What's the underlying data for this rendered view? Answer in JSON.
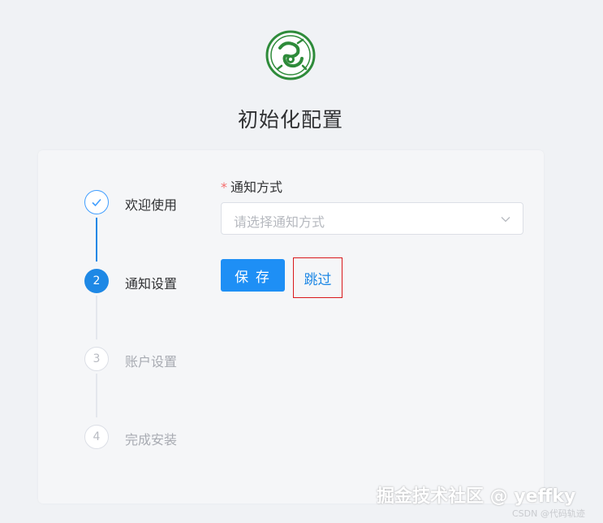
{
  "page": {
    "title": "初始化配置"
  },
  "steps": [
    {
      "label": "欢迎使用",
      "status": "done",
      "number": ""
    },
    {
      "label": "通知设置",
      "status": "active",
      "number": "2"
    },
    {
      "label": "账户设置",
      "status": "wait",
      "number": "3"
    },
    {
      "label": "完成安装",
      "status": "wait",
      "number": "4"
    }
  ],
  "form": {
    "notify_label": "通知方式",
    "required_mark": "*",
    "notify_placeholder": "请选择通知方式",
    "save_label": "保 存",
    "skip_label": "跳过"
  },
  "colors": {
    "primary": "#1e88e5",
    "required": "#f56c6c",
    "highlight_border": "#d9191c"
  },
  "watermark": {
    "text": "掘金技术社区 @ yeffky",
    "sub": "CSDN @代码轨迹"
  }
}
